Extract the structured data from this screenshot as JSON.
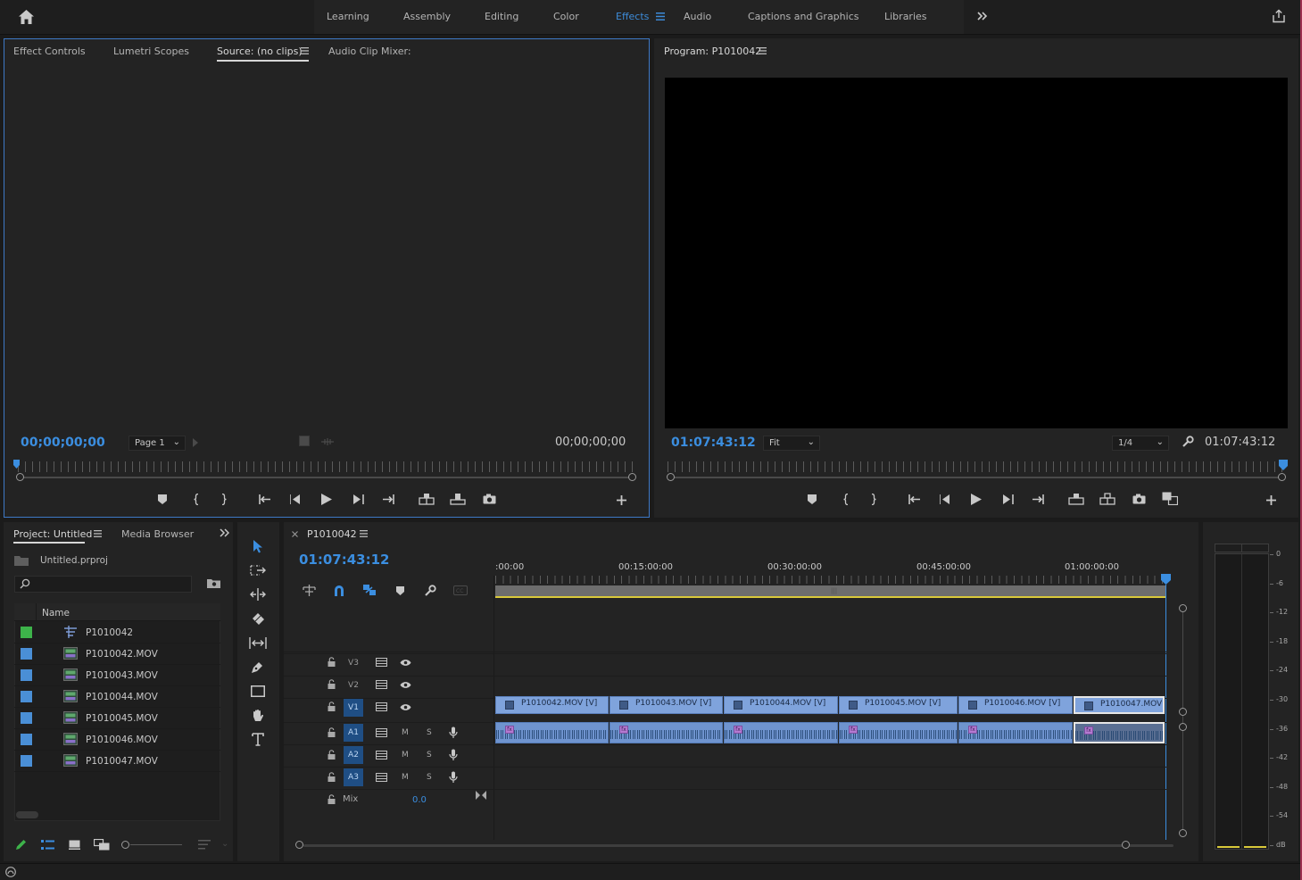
{
  "workspaces": {
    "items": [
      "Learning",
      "Assembly",
      "Editing",
      "Color",
      "Effects",
      "Audio",
      "Captions and Graphics",
      "Libraries"
    ],
    "active": "Effects"
  },
  "source_panel": {
    "tabs": [
      "Effect Controls",
      "Lumetri Scopes",
      "Source: (no clips)",
      "Audio Clip Mixer:"
    ],
    "active_tab": "Source: (no clips)",
    "timecode_in": "00;00;00;00",
    "timecode_out": "00;00;00;00",
    "page_select": "Page 1"
  },
  "program_panel": {
    "title": "Program: P1010042",
    "timecode": "01:07:43:12",
    "timecode_right": "01:07:43:12",
    "zoom": "Fit",
    "resolution": "1/4"
  },
  "project_panel": {
    "tabs": [
      "Project: Untitled",
      "Media Browser"
    ],
    "file": "Untitled.prproj",
    "search_placeholder": "",
    "column_name": "Name",
    "items": [
      {
        "name": "P1010042",
        "color": "#3db34a",
        "kind": "sequence"
      },
      {
        "name": "P1010042.MOV",
        "color": "#4a8fd6",
        "kind": "clip"
      },
      {
        "name": "P1010043.MOV",
        "color": "#4a8fd6",
        "kind": "clip"
      },
      {
        "name": "P1010044.MOV",
        "color": "#4a8fd6",
        "kind": "clip"
      },
      {
        "name": "P1010045.MOV",
        "color": "#4a8fd6",
        "kind": "clip"
      },
      {
        "name": "P1010046.MOV",
        "color": "#4a8fd6",
        "kind": "clip"
      },
      {
        "name": "P1010047.MOV",
        "color": "#4a8fd6",
        "kind": "clip"
      }
    ]
  },
  "timeline": {
    "sequence_tab": "P1010042",
    "timecode": "01:07:43:12",
    "ruler_labels": [
      ":00:00",
      "00:15:00:00",
      "00:30:00:00",
      "00:45:00:00",
      "01:00:00:00"
    ],
    "video_tracks": [
      "V3",
      "V2",
      "V1"
    ],
    "audio_tracks": [
      "A1",
      "A2",
      "A3"
    ],
    "mute_label": "M",
    "solo_label": "S",
    "mix_label": "Mix",
    "mix_value": "0.0",
    "video_clips": [
      "P1010042.MOV [V]",
      "P1010043.MOV [V]",
      "P1010044.MOV [V]",
      "P1010045.MOV [V]",
      "P1010046.MOV [V]",
      "P1010047.MOV"
    ],
    "fx_label": "fx"
  },
  "audio_meter": {
    "scale": [
      "0",
      "-6",
      "-12",
      "-18",
      "-24",
      "-30",
      "-36",
      "-42",
      "-48",
      "-54",
      "dB"
    ]
  }
}
